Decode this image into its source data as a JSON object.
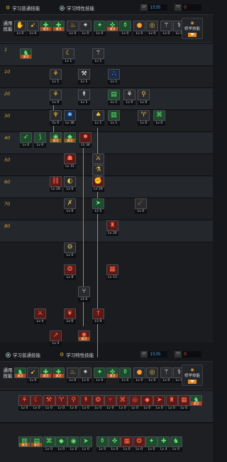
{
  "top": {
    "tabs": [
      {
        "label": "学习普通技能"
      },
      {
        "label": "学习特性技能"
      }
    ],
    "sp": {
      "label": "SP",
      "value": "1535"
    },
    "tp": {
      "label": "TP",
      "value": "0"
    }
  },
  "general": {
    "label": "通用技能",
    "unlearn_label": "修学技能",
    "skills": [
      {
        "icon": "hand",
        "color": "dark",
        "tone": "white",
        "tag": "",
        "lv": "Lv 0"
      },
      {
        "icon": "swift",
        "color": "dark",
        "tone": "gold",
        "tag": "",
        "lv": "Lv 0"
      },
      {
        "icon": "green-buff",
        "color": "green",
        "tone": "",
        "tag": "激活",
        "lv": ""
      },
      {
        "icon": "green-buff",
        "color": "green",
        "tone": "",
        "tag": "激活",
        "lv": ""
      },
      {
        "icon": "flame",
        "color": "dark",
        "tone": "gold",
        "tag": "",
        "lv": "Lv 0"
      },
      {
        "icon": "burst",
        "color": "dark",
        "tone": "white",
        "tag": "",
        "lv": "Lv 0"
      },
      {
        "icon": "green-star",
        "color": "green",
        "tone": "",
        "tag": "",
        "lv": "Lv 0"
      },
      {
        "icon": "green-cross",
        "color": "green",
        "tone": "",
        "tag": "激活",
        "lv": ""
      },
      {
        "icon": "green-pot",
        "color": "green",
        "tone": "",
        "tag": "",
        "lv": "Lv 0"
      },
      {
        "icon": "orb",
        "color": "dark",
        "tone": "orange",
        "tag": "",
        "lv": "Lv 0"
      },
      {
        "icon": "ring",
        "color": "dark",
        "tone": "gold",
        "tag": "",
        "lv": "Lv 0"
      },
      {
        "icon": "wing",
        "color": "dark",
        "tone": "white",
        "tag": "",
        "lv": "Lv 0"
      },
      {
        "icon": "wand",
        "color": "dark",
        "tone": "white",
        "tag": "",
        "lv": "Lv 0"
      },
      {
        "icon": "rise",
        "color": "green",
        "tone": "",
        "tag": "激活",
        "lv": ""
      }
    ]
  },
  "levels": [
    "1",
    "10",
    "20",
    "30",
    "40",
    "50",
    "60",
    "70",
    "80"
  ],
  "tree": [
    {
      "icon": "green-man",
      "color": "green",
      "tone": "",
      "tag": "激活",
      "lv": ""
    },
    {
      "icon": "sickle",
      "color": "dark",
      "tone": "gold",
      "tag": "",
      "lv": "Lv 1"
    },
    {
      "icon": "wing",
      "color": "dark",
      "tone": "white",
      "tag": "",
      "lv": "Lv 1"
    },
    {
      "icon": "claw",
      "color": "dark",
      "tone": "gold",
      "tag": "",
      "lv": "Lv 1"
    },
    {
      "icon": "axe",
      "color": "dark",
      "tone": "white",
      "tag": "",
      "lv": "Lv 1"
    },
    {
      "icon": "drops",
      "color": "dark",
      "tone": "blue",
      "tag": "",
      "lv": "Lv 1"
    },
    {
      "icon": "claw",
      "color": "dark",
      "tone": "gold",
      "tag": "",
      "lv": "Lv 0"
    },
    {
      "icon": "spear",
      "color": "dark",
      "tone": "white",
      "tag": "",
      "lv": "Lv 1"
    },
    {
      "icon": "green-book",
      "color": "green",
      "tone": "",
      "tag": "",
      "lv": "Lv 1"
    },
    {
      "icon": "claw",
      "color": "dark",
      "tone": "white",
      "tag": "",
      "lv": "Lv 0"
    },
    {
      "icon": "staff",
      "color": "dark",
      "tone": "gold",
      "tag": "",
      "lv": "Lv 0"
    },
    {
      "icon": "totem",
      "color": "dark",
      "tone": "gold",
      "tag": "",
      "lv": "Lv 0"
    },
    {
      "icon": "spark",
      "color": "blue",
      "tone": "",
      "tag": "",
      "lv": "Lv 36"
    },
    {
      "icon": "tooth",
      "color": "dark",
      "tone": "gold",
      "tag": "",
      "lv": "Lv 1"
    },
    {
      "icon": "green-bar",
      "color": "green",
      "tone": "",
      "tag": "",
      "lv": "Lv 1"
    },
    {
      "icon": "horn",
      "color": "dark",
      "tone": "gold",
      "tag": "",
      "lv": "Lv 0"
    },
    {
      "icon": "green-rune",
      "color": "green",
      "tone": "",
      "tag": "",
      "lv": "Lv 0"
    },
    {
      "icon": "bow",
      "color": "green",
      "tone": "",
      "tag": "",
      "lv": "Lv 0"
    },
    {
      "icon": "hook",
      "color": "green",
      "tone": "",
      "tag": "",
      "lv": "Lv 0"
    },
    {
      "icon": "green-ring",
      "color": "green",
      "tone": "",
      "tag": "激活",
      "lv": ""
    },
    {
      "icon": "green-gem",
      "color": "green",
      "tone": "",
      "tag": "激活",
      "lv": ""
    },
    {
      "icon": "fire-burst",
      "color": "red",
      "tone": "",
      "tag": "",
      "lv": "Lv 34"
    },
    {
      "icon": "slash",
      "color": "dark",
      "tone": "gold",
      "tag": "",
      "lv": "Lv 1"
    },
    {
      "icon": "red-mask",
      "color": "red",
      "tone": "",
      "tag": "",
      "lv": "Lv 31"
    },
    {
      "icon": "flask",
      "color": "dark",
      "tone": "gold",
      "tag": "",
      "lv": "Lv 1"
    },
    {
      "icon": "red-chain",
      "color": "red",
      "tone": "",
      "tag": "",
      "lv": "Lv 29"
    },
    {
      "icon": "coin",
      "color": "dark",
      "tone": "gold",
      "tag": "",
      "lv": "Lv 0"
    },
    {
      "icon": "red-fist",
      "color": "red",
      "tone": "",
      "tag": "",
      "lv": "Lv 29"
    },
    {
      "icon": "cross-blade",
      "color": "dark",
      "tone": "gold",
      "tag": "",
      "lv": "Lv 0"
    },
    {
      "icon": "green-dash",
      "color": "green",
      "tone": "",
      "tag": "",
      "lv": "Lv 5"
    },
    {
      "icon": "comet",
      "color": "dark",
      "tone": "gold",
      "tag": "",
      "lv": "Lv 0"
    },
    {
      "icon": "red-tower",
      "color": "red",
      "tone": "",
      "tag": "",
      "lv": "Lv 24"
    },
    {
      "icon": "gear",
      "color": "dark",
      "tone": "gold",
      "tag": "",
      "lv": "Lv 0"
    },
    {
      "icon": "red-core",
      "color": "red",
      "tone": "",
      "tag": "",
      "lv": "Lv 8"
    },
    {
      "icon": "red-net",
      "color": "red",
      "tone": "",
      "tag": "",
      "lv": "Lv 13"
    },
    {
      "icon": "fork",
      "color": "dark",
      "tone": "white",
      "tag": "",
      "lv": "Lv 0"
    },
    {
      "icon": "red-blade",
      "color": "red",
      "tone": "",
      "tag": "",
      "lv": "Lv 4"
    },
    {
      "icon": "red-heart",
      "color": "red",
      "tone": "",
      "tag": "",
      "lv": "Lv 6"
    },
    {
      "icon": "red-sword",
      "color": "red",
      "tone": "",
      "tag": "",
      "lv": "Lv 9"
    },
    {
      "icon": "red-lance",
      "color": "red",
      "tone": "",
      "tag": "",
      "lv": "Lv 4"
    },
    {
      "icon": "nova",
      "color": "red",
      "tone": "",
      "tag": "激活",
      "lv": ""
    }
  ],
  "bottom": {
    "tabs": [
      {
        "label": "学习普通技能"
      },
      {
        "label": "学习特性技能"
      }
    ],
    "sp": {
      "label": "SP",
      "value": "1535"
    },
    "tp": {
      "label": "TP",
      "value": "0"
    },
    "general_label": "通用技能",
    "unlearn_label": "修学技能",
    "general": [
      {
        "icon": "green-man",
        "color": "green",
        "tone": "",
        "tag": "激活",
        "lv": ""
      },
      {
        "icon": "swift",
        "color": "dark",
        "tone": "gold",
        "tag": "",
        "lv": "Lv 0"
      },
      {
        "icon": "green-buff",
        "color": "green",
        "tone": "",
        "tag": "激活",
        "lv": ""
      },
      {
        "icon": "green-buff",
        "color": "green",
        "tone": "",
        "tag": "激活",
        "lv": ""
      },
      {
        "icon": "flame",
        "color": "dark",
        "tone": "gold",
        "tag": "",
        "lv": "Lv 0"
      },
      {
        "icon": "burst",
        "color": "dark",
        "tone": "white",
        "tag": "",
        "lv": "Lv 0"
      },
      {
        "icon": "green-star",
        "color": "green",
        "tone": "",
        "tag": "",
        "lv": "Lv 0"
      },
      {
        "icon": "green-cross",
        "color": "green",
        "tone": "",
        "tag": "激活",
        "lv": ""
      },
      {
        "icon": "green-pot",
        "color": "green",
        "tone": "",
        "tag": "",
        "lv": "Lv 0"
      },
      {
        "icon": "orb",
        "color": "dark",
        "tone": "orange",
        "tag": "",
        "lv": "Lv 0"
      },
      {
        "icon": "ring",
        "color": "dark",
        "tone": "gold",
        "tag": "",
        "lv": "Lv 0"
      },
      {
        "icon": "wing",
        "color": "dark",
        "tone": "white",
        "tag": "",
        "lv": "Lv 0"
      },
      {
        "icon": "wand",
        "color": "dark",
        "tone": "white",
        "tag": "",
        "lv": "Lv 0"
      },
      {
        "icon": "rise",
        "color": "green",
        "tone": "",
        "tag": "激活",
        "lv": ""
      }
    ],
    "row1": [
      {
        "icon": "red-claw",
        "color": "red",
        "tone": "",
        "tag": "",
        "lv": "Lv 0"
      },
      {
        "icon": "red-sickle",
        "color": "red",
        "tone": "",
        "tag": "",
        "lv": "Lv 0"
      },
      {
        "icon": "red-axe",
        "color": "red",
        "tone": "",
        "tag": "",
        "lv": "Lv 0"
      },
      {
        "icon": "red-horn",
        "color": "red",
        "tone": "",
        "tag": "",
        "lv": "Lv 0"
      },
      {
        "icon": "red-staff",
        "color": "red",
        "tone": "",
        "tag": "",
        "lv": "Lv 0"
      },
      {
        "icon": "red-spear",
        "color": "red",
        "tone": "",
        "tag": "",
        "lv": "Lv 0"
      },
      {
        "icon": "red-core",
        "color": "red",
        "tone": "",
        "tag": "",
        "lv": "Lv 0"
      },
      {
        "icon": "red-fork",
        "color": "red",
        "tone": "",
        "tag": "",
        "lv": "Lv 0"
      },
      {
        "icon": "red-rune",
        "color": "red",
        "tone": "",
        "tag": "",
        "lv": "Lv 0"
      },
      {
        "icon": "red-ring",
        "color": "red",
        "tone": "",
        "tag": "",
        "lv": "Lv 0"
      },
      {
        "icon": "red-gem",
        "color": "red",
        "tone": "",
        "tag": "",
        "lv": "Lv 0"
      },
      {
        "icon": "red-dash",
        "color": "red",
        "tone": "",
        "tag": "",
        "lv": "Lv 0"
      },
      {
        "icon": "red-tower",
        "color": "red",
        "tone": "",
        "tag": "",
        "lv": "Lv 0"
      },
      {
        "icon": "red-net",
        "color": "red",
        "tone": "",
        "tag": "",
        "lv": "Lv 0"
      },
      {
        "icon": "green-man",
        "color": "green",
        "tone": "",
        "tag": "激活",
        "lv": ""
      }
    ],
    "row2": [
      {
        "icon": "green-bar",
        "color": "green",
        "tone": "",
        "tag": "激活",
        "lv": ""
      },
      {
        "icon": "green-book",
        "color": "green",
        "tone": "",
        "tag": "激活",
        "lv": ""
      },
      {
        "icon": "green-rune",
        "color": "green",
        "tone": "",
        "tag": "",
        "lv": "Lv 0"
      },
      {
        "icon": "green-gem",
        "color": "green",
        "tone": "",
        "tag": "",
        "lv": "Lv 0"
      },
      {
        "icon": "green-ring",
        "color": "green",
        "tone": "",
        "tag": "",
        "lv": "Lv 0"
      },
      {
        "icon": "green-dash",
        "color": "green",
        "tone": "",
        "tag": "",
        "lv": "Lv 0"
      },
      {
        "icon": "green-pot",
        "color": "green",
        "tone": "",
        "tag": "",
        "lv": "Lv 0"
      },
      {
        "icon": "green-cross",
        "color": "green",
        "tone": "",
        "tag": "",
        "lv": "Lv 0"
      },
      {
        "icon": "red-net",
        "color": "red",
        "tone": "",
        "tag": "",
        "lv": "Lv 0"
      },
      {
        "icon": "red-core",
        "color": "red",
        "tone": "",
        "tag": "",
        "lv": "Lv 0"
      },
      {
        "icon": "green-star",
        "color": "green",
        "tone": "",
        "tag": "",
        "lv": "Lv 0"
      },
      {
        "icon": "green-buff",
        "color": "green",
        "tone": "",
        "tag": "",
        "lv": "Lv 4"
      },
      {
        "icon": "green-man",
        "color": "green",
        "tone": "",
        "tag": "",
        "lv": "Lv 0"
      }
    ]
  },
  "glyphs": {
    "hand": "✋",
    "swift": "➹",
    "green-buff": "✚",
    "flame": "♨",
    "burst": "✴",
    "green-star": "✦",
    "green-cross": "✜",
    "green-pot": "⚱",
    "orb": "●",
    "ring": "◎",
    "wing": "⚚",
    "wand": "⚕",
    "rise": "⤴",
    "green-man": "♞",
    "sickle": "☾",
    "claw": "⚘",
    "axe": "⚒",
    "drops": "∴",
    "spear": "↟",
    "green-book": "▤",
    "staff": "⚲",
    "totem": "♆",
    "spark": "✸",
    "tooth": "♠",
    "green-bar": "▥",
    "horn": "♈",
    "green-rune": "⌘",
    "bow": "➶",
    "hook": "⟆",
    "green-ring": "◉",
    "green-gem": "◆",
    "fire-burst": "✹",
    "slash": "⚔",
    "red-mask": "☗",
    "flask": "⚗",
    "red-chain": "⛓",
    "coin": "◐",
    "red-fist": "✊",
    "cross-blade": "✗",
    "green-dash": "➤",
    "comet": "☄",
    "red-tower": "♜",
    "gear": "⚙",
    "red-core": "❂",
    "red-net": "▦",
    "fork": "⑂",
    "red-blade": "⚔",
    "red-heart": "❦",
    "red-sword": "†",
    "red-lance": "↗",
    "nova": "✺",
    "red-claw": "⚘",
    "red-sickle": "☾",
    "red-axe": "⚒",
    "red-horn": "♈",
    "red-staff": "⚲",
    "red-spear": "↟",
    "red-fork": "⑂",
    "red-rune": "⌘",
    "red-ring": "◎",
    "red-gem": "◆",
    "red-dash": "➤"
  }
}
